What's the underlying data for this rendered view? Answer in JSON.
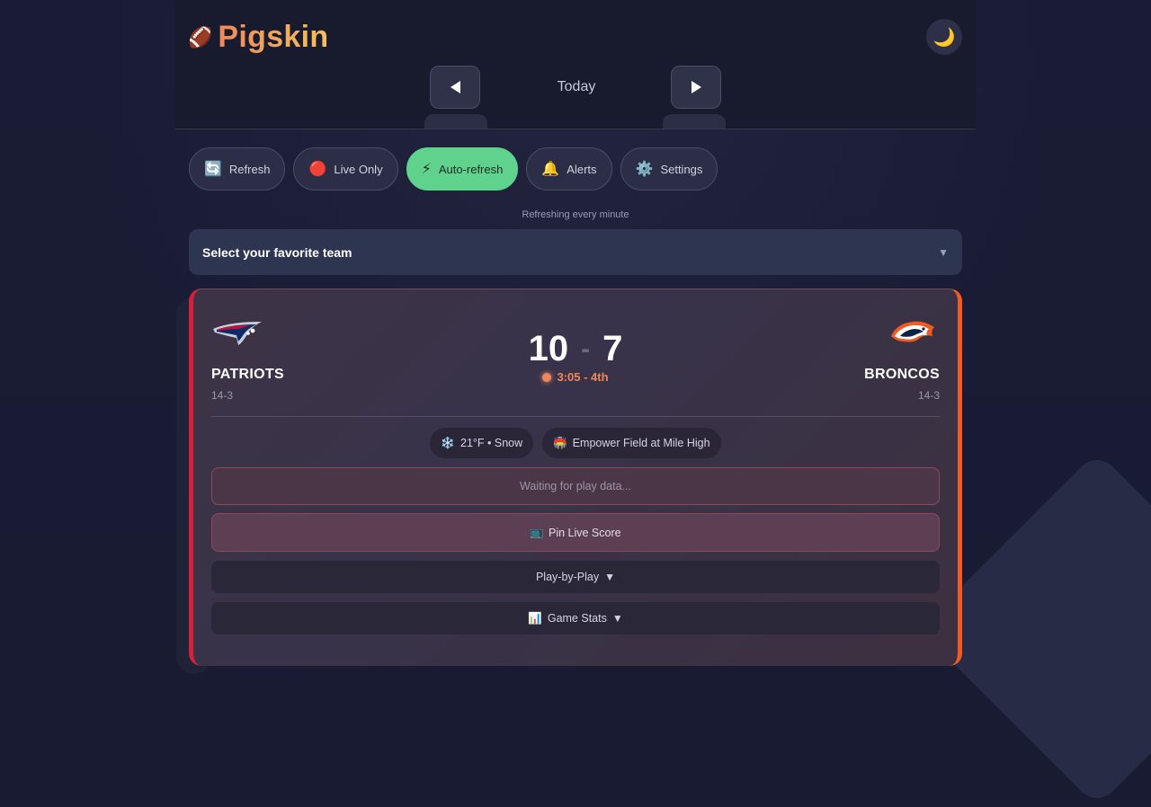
{
  "app": {
    "title": "Pigskin",
    "logo_icon": "🏈"
  },
  "header": {
    "theme_icon": "🌙",
    "date_label": "Today",
    "prev_icon": "chevron-left-icon",
    "next_icon": "chevron-right-icon"
  },
  "toolbar": {
    "buttons": [
      {
        "label": "Refresh",
        "icon": "🔄",
        "active": false
      },
      {
        "label": "Live Only",
        "icon": "🔴",
        "active": false
      },
      {
        "label": "Auto-refresh",
        "icon": "⚡",
        "active": true
      },
      {
        "label": "Alerts",
        "icon": "🔔",
        "active": false
      },
      {
        "label": "Settings",
        "icon": "⚙️",
        "active": false
      }
    ],
    "refresh_note": "Refreshing every minute"
  },
  "team_select": {
    "label": "Select your favorite team",
    "chevron": "▼"
  },
  "game": {
    "home": {
      "name": "PATRIOTS",
      "record": "14-3",
      "score": "10",
      "color": "#d81f3a"
    },
    "away": {
      "name": "BRONCOS",
      "record": "14-3",
      "score": "7",
      "color": "#f15a24"
    },
    "score_separator": "-",
    "clock": "3:05 - 4th",
    "weather": {
      "icon": "❄️",
      "text": "21°F • Snow"
    },
    "venue": {
      "icon": "🏟️",
      "text": "Empower Field at Mile High"
    },
    "waiting_text": "Waiting for play data...",
    "pin_label": "Pin Live Score",
    "pin_icon": "📺",
    "play_by_play_label": "Play-by-Play",
    "game_stats_label": "Game Stats",
    "game_stats_icon": "📊",
    "expander_caret": "▼"
  },
  "colors": {
    "accent_green": "#5fd38e",
    "accent_orange": "#f0875a",
    "brand_gradient_end": "#f2c060"
  }
}
